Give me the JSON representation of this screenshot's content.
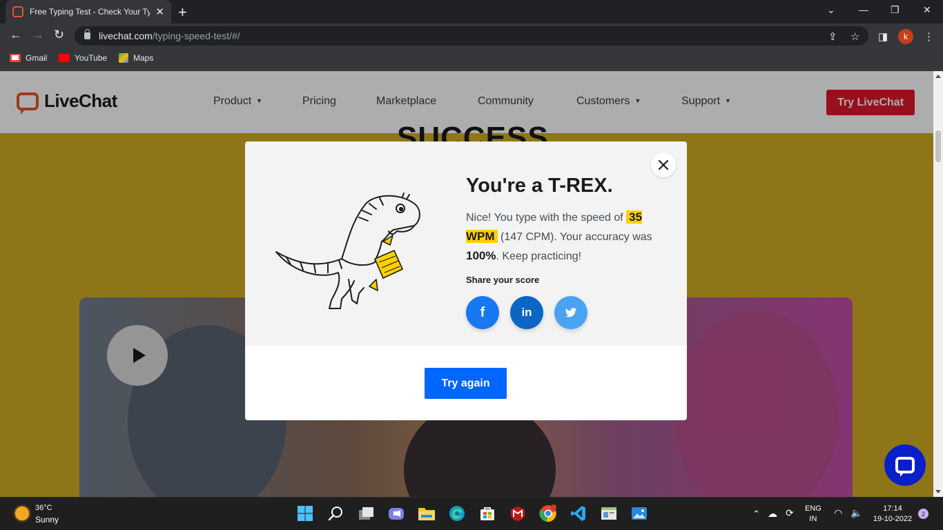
{
  "browser": {
    "tab_title": "Free Typing Test - Check Your Typing Speed",
    "url_host": "livechat.com",
    "url_path": "/typing-speed-test/#/",
    "profile_initial": "k",
    "bookmarks": [
      "Gmail",
      "YouTube",
      "Maps"
    ]
  },
  "site": {
    "logo_text": "LiveChat",
    "nav": [
      "Product",
      "Pricing",
      "Marketplace",
      "Community",
      "Customers",
      "Support"
    ],
    "cta": "Try LiveChat",
    "heading_peek": "SUCCESS"
  },
  "modal": {
    "title": "You're a T-REX.",
    "text_before": "Nice! You type with the speed of ",
    "wpm": "35 WPM",
    "text_mid": " (147 CPM). Your accuracy was ",
    "accuracy": "100%",
    "text_after": ". Keep practicing!",
    "share_label": "Share your score",
    "social": [
      "f",
      "in",
      "twitter"
    ],
    "try_again": "Try again"
  },
  "taskbar": {
    "temp": "36°C",
    "weather": "Sunny",
    "lang_top": "ENG",
    "lang_bottom": "IN",
    "time": "17:14",
    "date": "19-10-2022",
    "notifications": "2"
  },
  "colors": {
    "brand": "#e8542b",
    "cta": "#e2172d",
    "primary": "#0066ff",
    "highlight": "#ffd000",
    "page_bg": "#d2ae24"
  }
}
